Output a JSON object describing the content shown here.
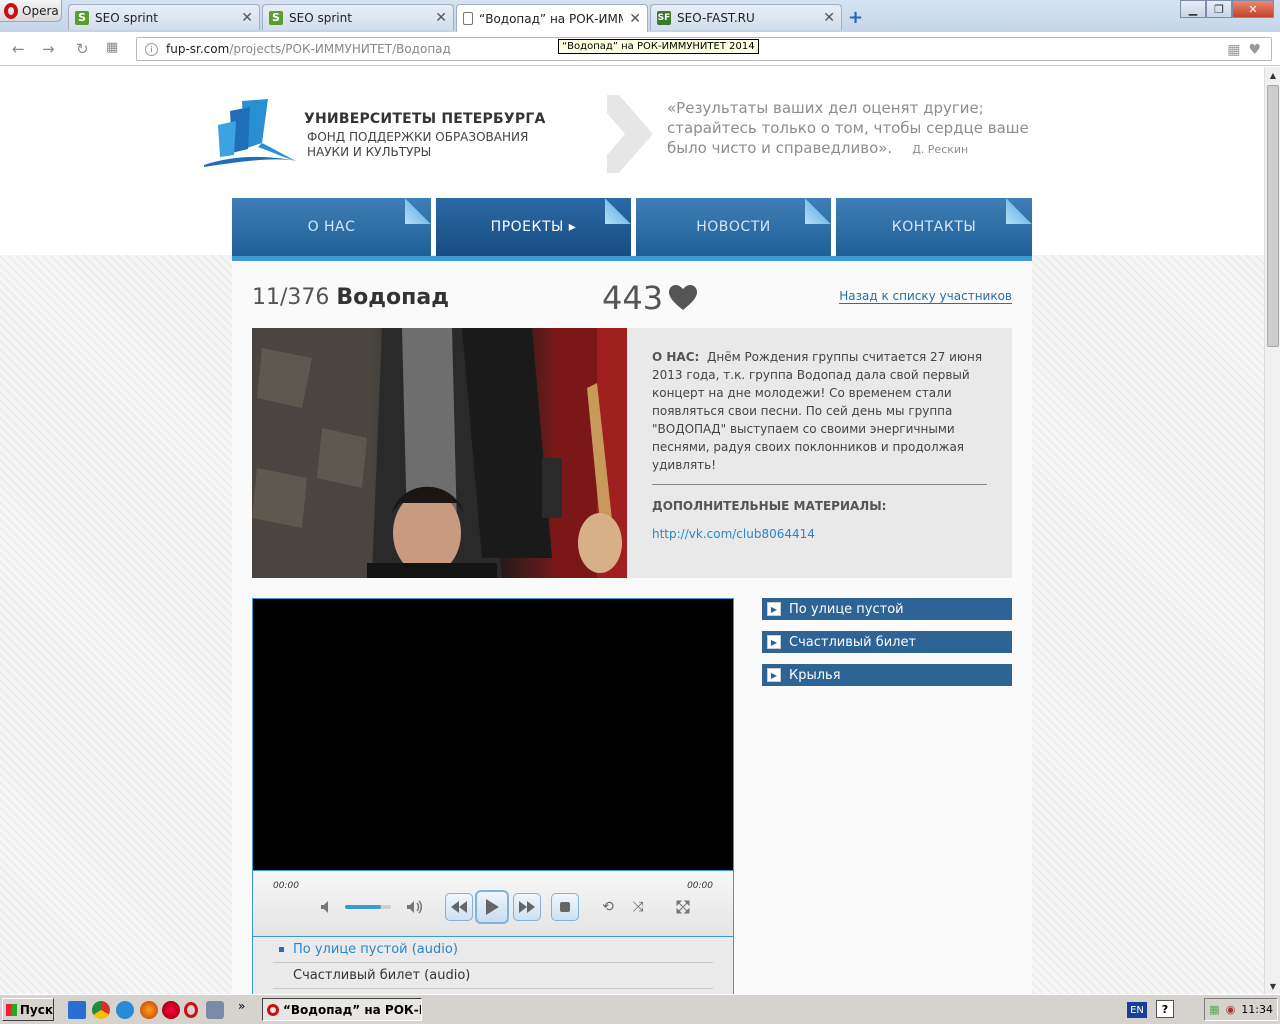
{
  "browser": {
    "menu_label": "Opera",
    "tabs": [
      {
        "title": "SEO sprint",
        "icon": "seo-sprint-favicon"
      },
      {
        "title": "SEO sprint",
        "icon": "seo-sprint-favicon"
      },
      {
        "title": "“Водопад” на РОК-ИММУНИТЕТ 2014",
        "icon": "document-icon"
      },
      {
        "title": "SEO-FAST.RU",
        "icon": "seo-fast-favicon"
      }
    ],
    "address": {
      "host": "fup-sr.com",
      "path": "/projects/РОК-ИММУНИТЕТ/Водопад"
    },
    "tooltip": "“Водопад” на РОК-ИММУНИТЕТ 2014"
  },
  "header": {
    "logo_title": "УНИВЕРСИТЕТЫ ПЕТЕРБУРГА",
    "logo_sub1": "ФОНД ПОДДЕРЖКИ ОБРАЗОВАНИЯ",
    "logo_sub2": "НАУКИ И КУЛЬТУРЫ",
    "quote": "«Результаты ваших дел оценят другие; старайтесь только о том, чтобы сердце ваше было чисто и справедливо».",
    "quote_author": "Д. Рескин"
  },
  "menu": [
    {
      "label": "О НАС"
    },
    {
      "label": "ПРОЕКТЫ ▸"
    },
    {
      "label": "НОВОСТИ"
    },
    {
      "label": "КОНТАКТЫ"
    }
  ],
  "project": {
    "rank": "11/376",
    "name": "Водопад",
    "votes": "443",
    "back_link": "Назад к списку участников",
    "about_label": "О НАС:",
    "about_text": "Днём Рождения группы считается 27 июня 2013 года, т.к. группа Водопад дала свой первый концерт на дне молодежи! Со временем стали появляться свои песни. По сей день мы группа \"ВОДОПАД\" выступаем со своими энергичными песнями, радуя своих поклонников и продолжая удивлять!",
    "extra_label": "ДОПОЛНИТЕЛЬНЫЕ МАТЕРИАЛЫ:",
    "extra_link": "http://vk.com/club8064414"
  },
  "player": {
    "time_current": "00:00",
    "time_total": "00:00",
    "volume": 0.78,
    "playlist": [
      "По улице пустой (audio)",
      "Счастливый билет (audio)"
    ]
  },
  "tracks": [
    "По улице пустой",
    "Счастливый билет",
    "Крылья"
  ],
  "taskbar": {
    "start_label": "Пуск",
    "task_title": "“Водопад” на РОК-И...",
    "lang": "EN",
    "clock": "11:34"
  },
  "colors": {
    "accent": "#2e6396",
    "menu_blue": "#1f5f98",
    "link": "#2a86c8",
    "opera_red": "#cc0f16"
  }
}
